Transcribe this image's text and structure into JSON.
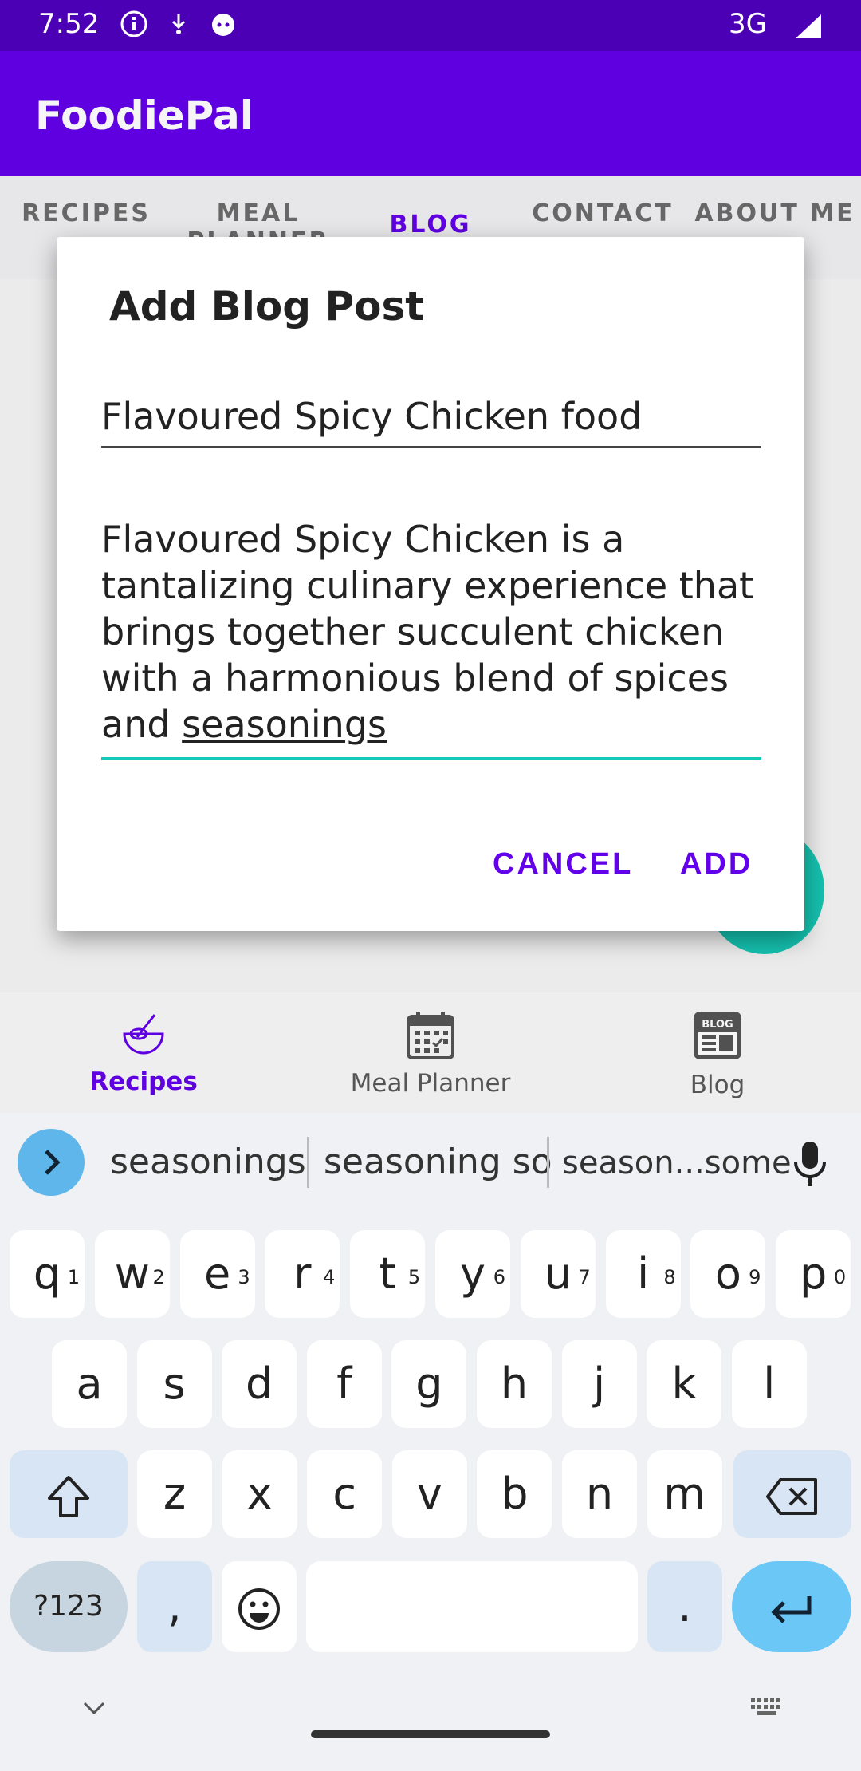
{
  "status": {
    "time": "7:52",
    "network": "3G"
  },
  "app": {
    "title": "FoodiePal"
  },
  "tabs": [
    "RECIPES",
    "MEAL PLANNER",
    "BLOG",
    "CONTACT",
    "ABOUT ME"
  ],
  "dialog": {
    "title": "Add Blog Post",
    "title_field_value": "Flavoured Spicy Chicken food",
    "body_field_value_main": "Flavoured Spicy Chicken is a tantalizing culinary experience that brings together succulent chicken with a harmonious blend of spices and ",
    "body_field_value_last": "seasonings",
    "cancel_label": "CANCEL",
    "add_label": "ADD"
  },
  "bottom_nav": [
    {
      "label": "Recipes",
      "icon": "whisk-bowl-icon",
      "active": true
    },
    {
      "label": "Meal Planner",
      "icon": "calendar-icon",
      "active": false
    },
    {
      "label": "Blog",
      "icon": "blog-icon",
      "active": false
    }
  ],
  "blog_icon_text": "BLOG",
  "keyboard": {
    "suggestions": [
      "seasonings",
      "seasoning so",
      "season...some"
    ],
    "row1": [
      {
        "k": "q",
        "n": "1"
      },
      {
        "k": "w",
        "n": "2"
      },
      {
        "k": "e",
        "n": "3"
      },
      {
        "k": "r",
        "n": "4"
      },
      {
        "k": "t",
        "n": "5"
      },
      {
        "k": "y",
        "n": "6"
      },
      {
        "k": "u",
        "n": "7"
      },
      {
        "k": "i",
        "n": "8"
      },
      {
        "k": "o",
        "n": "9"
      },
      {
        "k": "p",
        "n": "0"
      }
    ],
    "row2": [
      "a",
      "s",
      "d",
      "f",
      "g",
      "h",
      "j",
      "k",
      "l"
    ],
    "row3": [
      "z",
      "x",
      "c",
      "v",
      "b",
      "n",
      "m"
    ],
    "sym_label": "?123",
    "comma": ",",
    "period": "."
  },
  "colors": {
    "primary": "#6200ea",
    "status_bar": "#4b00b6",
    "accent": "#16c8b6"
  }
}
